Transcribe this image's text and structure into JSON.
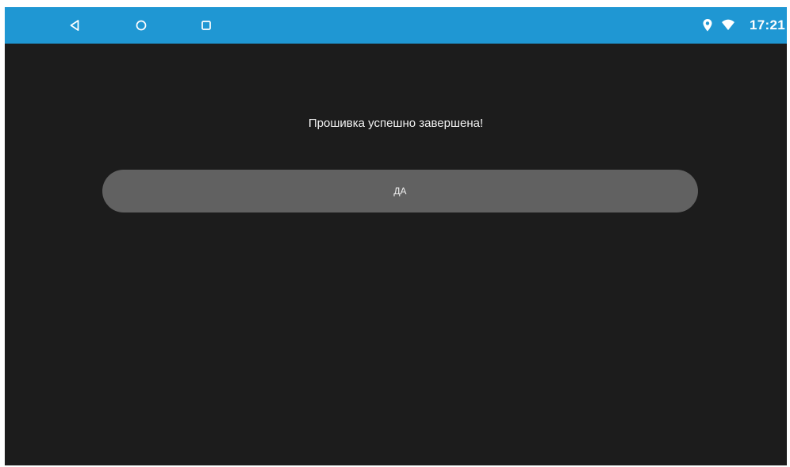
{
  "status_bar": {
    "time": "17:21",
    "icons": [
      "location-pin-icon",
      "wifi-icon"
    ]
  },
  "navigation": {
    "buttons": [
      "back-icon",
      "home-icon",
      "recent-apps-icon"
    ]
  },
  "dialog": {
    "message": "Прошивка успешно завершена!",
    "confirm_label": "ДА"
  },
  "colors": {
    "status_bar": "#1f97d3",
    "background": "#1c1c1c",
    "button": "#616161",
    "text": "#f2f2f2"
  }
}
